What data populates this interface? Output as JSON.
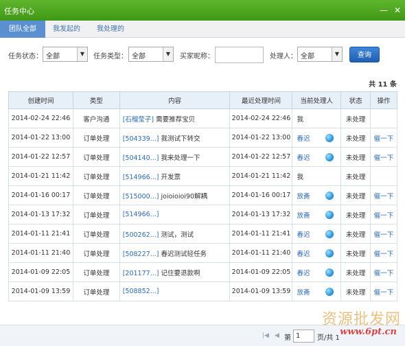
{
  "window": {
    "title": "任务中心"
  },
  "tabs": [
    {
      "label": "团队全部",
      "active": true
    },
    {
      "label": "我发起的",
      "active": false
    },
    {
      "label": "我处理的",
      "active": false
    }
  ],
  "filters": {
    "status_label": "任务状态：",
    "status_value": "全部",
    "type_label": "任务类型：",
    "type_value": "全部",
    "buyer_label": "买家昵称：",
    "buyer_value": "",
    "handler_label": "处理人：",
    "handler_value": "全部",
    "query_button": "查询"
  },
  "total": "共 11 条",
  "table": {
    "headers": [
      "创建时间",
      "类型",
      "内容",
      "最近处理时间",
      "当前处理人",
      "状态",
      "操作"
    ],
    "rows": [
      {
        "created": "2014-02-24 22:46",
        "type": "客户沟通",
        "link": "[石榴莹子]",
        "text": " 需要推荐宝贝",
        "updated": "2014-02-24 22:46",
        "handler": "我",
        "handler_is_link": false,
        "globe": false,
        "status": "未处理",
        "action": ""
      },
      {
        "created": "2014-01-22 13:00",
        "type": "订单处理",
        "link": "[504339...]",
        "text": " 我测试下转交",
        "updated": "2014-01-22 13:00",
        "handler": "春迟",
        "handler_is_link": true,
        "globe": true,
        "status": "未处理",
        "action": "催一下"
      },
      {
        "created": "2014-01-22 12:57",
        "type": "订单处理",
        "link": "[504140...]",
        "text": " 我来处理一下",
        "updated": "2014-01-22 12:57",
        "handler": "春迟",
        "handler_is_link": true,
        "globe": true,
        "status": "未处理",
        "action": "催一下"
      },
      {
        "created": "2014-01-21 11:42",
        "type": "订单处理",
        "link": "[514966...]",
        "text": " 开发票",
        "updated": "2014-01-21 11:42",
        "handler": "我",
        "handler_is_link": false,
        "globe": false,
        "status": "未处理",
        "action": ""
      },
      {
        "created": "2014-01-16 00:17",
        "type": "订单处理",
        "link": "[515000...]",
        "text": " joioioioi90解耦",
        "updated": "2014-01-16 00:17",
        "handler": "放斋",
        "handler_is_link": true,
        "globe": true,
        "status": "未处理",
        "action": "催一下"
      },
      {
        "created": "2014-01-13 17:32",
        "type": "订单处理",
        "link": "[514966...]",
        "text": "",
        "updated": "2014-01-13 17:32",
        "handler": "放斋",
        "handler_is_link": true,
        "globe": true,
        "status": "未处理",
        "action": "催一下"
      },
      {
        "created": "2014-01-11 21:41",
        "type": "订单处理",
        "link": "[500262...]",
        "text": " 测试，测试",
        "updated": "2014-01-11 21:41",
        "handler": "春迟",
        "handler_is_link": true,
        "globe": true,
        "status": "未处理",
        "action": "催一下"
      },
      {
        "created": "2014-01-11 21:40",
        "type": "订单处理",
        "link": "[508227...]",
        "text": " 春迟测试轻任务",
        "updated": "2014-01-11 21:40",
        "handler": "春迟",
        "handler_is_link": true,
        "globe": true,
        "status": "未处理",
        "action": "催一下"
      },
      {
        "created": "2014-01-09 22:05",
        "type": "订单处理",
        "link": "[201177...]",
        "text": " 记住要退款啊",
        "updated": "2014-01-09 22:05",
        "handler": "春迟",
        "handler_is_link": true,
        "globe": true,
        "status": "未处理",
        "action": "催一下"
      },
      {
        "created": "2014-01-09 13:59",
        "type": "订单处理",
        "link": "[508852...]",
        "text": "",
        "updated": "2014-01-09 13:59",
        "handler": "放斋",
        "handler_is_link": true,
        "globe": true,
        "status": "未处理",
        "action": "催一下"
      }
    ]
  },
  "pager": {
    "first": "|◀",
    "prev": "◀",
    "page_prefix": "第",
    "page_value": "1",
    "page_suffix": "页/共 1"
  },
  "watermark": {
    "text": "资源批发网",
    "url": "www.6pt.cn"
  }
}
